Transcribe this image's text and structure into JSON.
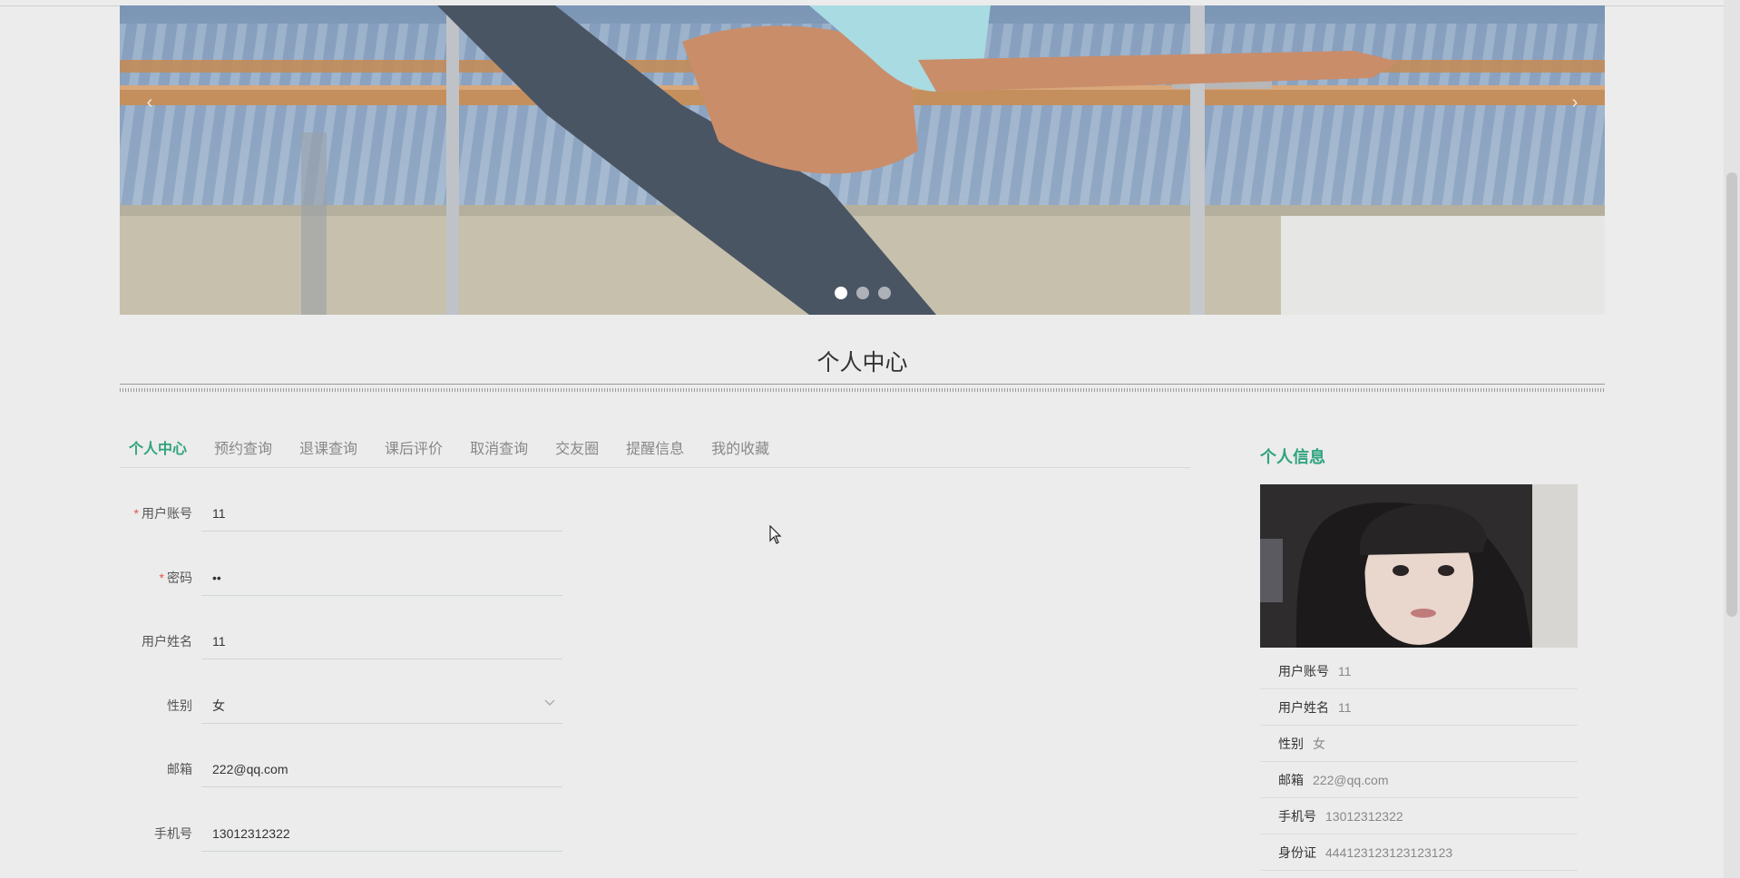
{
  "carousel": {
    "prev_icon": "chevron-left-icon",
    "next_icon": "chevron-right-icon",
    "prev_glyph": "‹",
    "next_glyph": "›",
    "slides_count": 3,
    "active_slide": 1
  },
  "page_title": "个人中心",
  "tabs": [
    {
      "label": "个人中心",
      "active": true
    },
    {
      "label": "预约查询",
      "active": false
    },
    {
      "label": "退课查询",
      "active": false
    },
    {
      "label": "课后评价",
      "active": false
    },
    {
      "label": "取消查询",
      "active": false
    },
    {
      "label": "交友圈",
      "active": false
    },
    {
      "label": "提醒信息",
      "active": false
    },
    {
      "label": "我的收藏",
      "active": false
    }
  ],
  "form": {
    "required_mark": "*",
    "account": {
      "label": "用户账号",
      "value": "11",
      "required": true
    },
    "password": {
      "label": "密码",
      "value": "11",
      "required": true
    },
    "name": {
      "label": "用户姓名",
      "value": "11",
      "required": false
    },
    "gender": {
      "label": "性别",
      "value": "女",
      "options": [
        "女"
      ],
      "required": false
    },
    "email": {
      "label": "邮箱",
      "value": "222@qq.com",
      "required": false
    },
    "phone": {
      "label": "手机号",
      "value": "13012312322",
      "required": false
    }
  },
  "profile": {
    "title": "个人信息",
    "rows": [
      {
        "key": "用户账号",
        "value": "11"
      },
      {
        "key": "用户姓名",
        "value": "11"
      },
      {
        "key": "性别",
        "value": "女"
      },
      {
        "key": "邮箱",
        "value": "222@qq.com"
      },
      {
        "key": "手机号",
        "value": "13012312322"
      },
      {
        "key": "身份证",
        "value": "444123123123123123"
      }
    ]
  },
  "colors": {
    "accent": "#2fa37e",
    "background": "#ececec",
    "required": "#e05656"
  }
}
